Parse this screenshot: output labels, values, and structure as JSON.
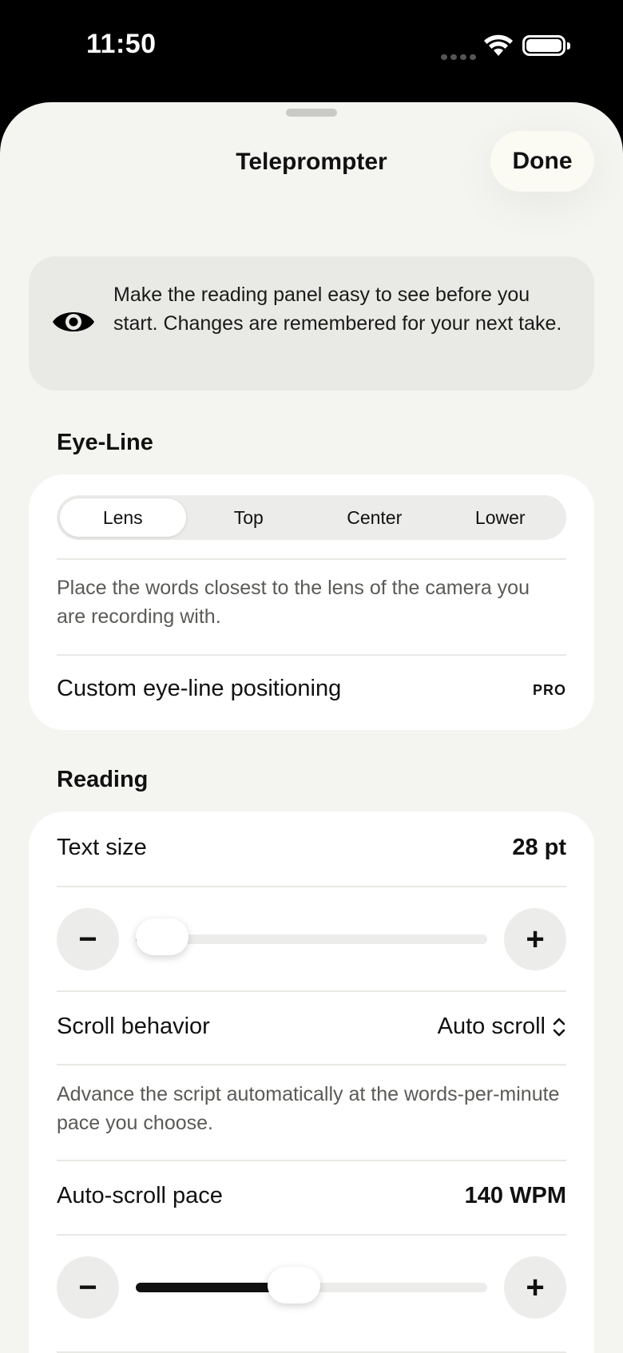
{
  "status": {
    "time": "11:50"
  },
  "header": {
    "title": "Teleprompter",
    "done_label": "Done"
  },
  "info": {
    "icon": "eye-icon",
    "text": "Make the reading panel easy to see before you start. Changes are remembered for your next take."
  },
  "eye_line": {
    "section_title": "Eye-Line",
    "options": [
      "Lens",
      "Top",
      "Center",
      "Lower"
    ],
    "selected": "Lens",
    "description": "Place the words closest to the lens of the camera you are recording with.",
    "custom_label": "Custom eye-line positioning",
    "pro_badge": "PRO"
  },
  "reading": {
    "section_title": "Reading",
    "text_size_label": "Text size",
    "text_size_value": "28 pt",
    "text_size_level": 0.07,
    "scroll_behavior_label": "Scroll behavior",
    "scroll_behavior_value": "Auto scroll",
    "scroll_description": "Advance the script automatically at the words-per-minute pace you choose.",
    "pace_label": "Auto-scroll pace",
    "pace_value": "140 WPM",
    "pace_level": 0.45,
    "minus_label": "−",
    "plus_label": "+"
  },
  "colors": {
    "sheet_bg": "#f4f4f1",
    "card_bg": "#ffffff",
    "accent": "#111111"
  }
}
